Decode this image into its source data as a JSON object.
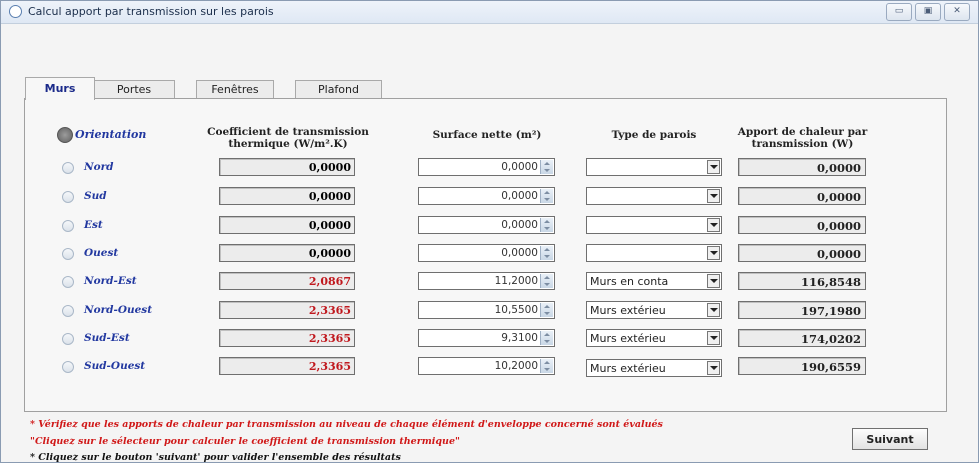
{
  "window": {
    "title": "Calcul apport par transmission sur les parois",
    "controls": [
      "▭",
      "▣",
      "✕"
    ]
  },
  "tabs": [
    {
      "label": "Murs",
      "active": true
    },
    {
      "label": "Portes",
      "active": false
    },
    {
      "label": "Fenêtres",
      "active": false
    },
    {
      "label": "Plafond",
      "active": false
    }
  ],
  "headers": {
    "orientation": "Orientation",
    "coefficient": [
      "Coefficient de transmission",
      "thermique (W/m².K)"
    ],
    "surface": "Surface nette (m²)",
    "type": "Type de parois",
    "apport": [
      "Apport de chaleur par",
      "transmission (W)"
    ]
  },
  "rows": [
    {
      "label": "Nord",
      "coef": "0,0000",
      "surface": "0,0000",
      "type": "",
      "apport": "0,0000"
    },
    {
      "label": "Sud",
      "coef": "0,0000",
      "surface": "0,0000",
      "type": "",
      "apport": "0,0000"
    },
    {
      "label": "Est",
      "coef": "0,0000",
      "surface": "0,0000",
      "type": "",
      "apport": "0,0000"
    },
    {
      "label": "Ouest",
      "coef": "0,0000",
      "surface": "0,0000",
      "type": "",
      "apport": "0,0000"
    },
    {
      "label": "Nord-Est",
      "coef": "2,0867",
      "surface": "11,2000",
      "type": "Murs en conta",
      "apport": "116,8548"
    },
    {
      "label": "Nord-Ouest",
      "coef": "2,3365",
      "surface": "10,5500",
      "type": "Murs extérieu",
      "apport": "197,1980"
    },
    {
      "label": "Sud-Est",
      "coef": "2,3365",
      "surface": "9,3100",
      "type": "Murs extérieu",
      "apport": "174,0202"
    },
    {
      "label": "Sud-Ouest",
      "coef": "2,3365",
      "surface": "10,2000",
      "type": "Murs extérieu",
      "apport": "190,6559"
    }
  ],
  "notes": [
    "* Vérifiez que les apports de chaleur par transmission au niveau de chaque élément d'enveloppe concerné sont évalués",
    "\"Cliquez sur le sélecteur pour calculer le coefficient de transmission thermique\"",
    "* Cliquez sur le bouton 'suivant' pour valider l'ensemble des résultats"
  ],
  "buttons": {
    "next": "Suivant"
  },
  "colors": {
    "label_blue": "#2238a0",
    "value_red": "#c0181e",
    "note_red": "#d01818"
  }
}
